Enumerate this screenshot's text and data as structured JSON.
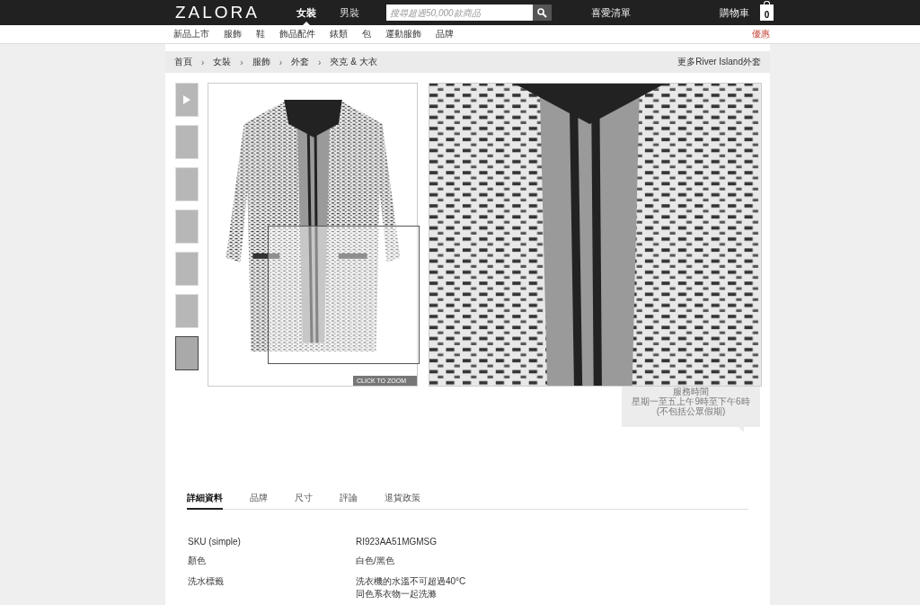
{
  "header": {
    "logo": "ZALORA",
    "gender_tabs": [
      {
        "label": "女裝",
        "selected": true
      },
      {
        "label": "男裝",
        "selected": false
      }
    ],
    "search": {
      "placeholder": "搜尋超過50,000款商品"
    },
    "wishlist": "喜愛清單",
    "cart": {
      "label": "購物車",
      "count": "0"
    }
  },
  "nav": {
    "items": [
      "新品上市",
      "服飾",
      "鞋",
      "飾品配件",
      "錶類",
      "包",
      "運動服飾",
      "品牌"
    ],
    "promo": "優惠"
  },
  "breadcrumb": {
    "items": [
      "首頁",
      "女裝",
      "服飾",
      "外套",
      "夾克 & 大衣"
    ],
    "separator": "›",
    "more_link": "更多River Island外套"
  },
  "gallery": {
    "thumbnails": [
      {
        "kind": "video",
        "selected": false
      },
      {
        "kind": "photo",
        "selected": false
      },
      {
        "kind": "photo",
        "selected": false
      },
      {
        "kind": "photo",
        "selected": false
      },
      {
        "kind": "photo",
        "selected": false
      },
      {
        "kind": "photo",
        "selected": false
      },
      {
        "kind": "photo",
        "selected": true
      }
    ],
    "zoom_button": "CLICK TO ZOOM"
  },
  "tooltip": {
    "lines": [
      "服務時間",
      "星期一至五上午9時至下午6時",
      "(不包括公眾假期)"
    ]
  },
  "detail_tabs": [
    {
      "label": "詳細資料",
      "selected": true
    },
    {
      "label": "品牌",
      "selected": false
    },
    {
      "label": "尺寸",
      "selected": false
    },
    {
      "label": "評論",
      "selected": false
    },
    {
      "label": "退貨政策",
      "selected": false
    }
  ],
  "details": [
    {
      "label": "SKU (simple)",
      "value_lines": [
        "RI923AA51MGMSG"
      ]
    },
    {
      "label": "顏色",
      "value_lines": [
        "白色/黑色"
      ]
    },
    {
      "label": "洗水標籤",
      "value_lines": [
        "洗衣機的水溫不可超過40°C",
        "同色系衣物一起洗滌"
      ]
    }
  ]
}
